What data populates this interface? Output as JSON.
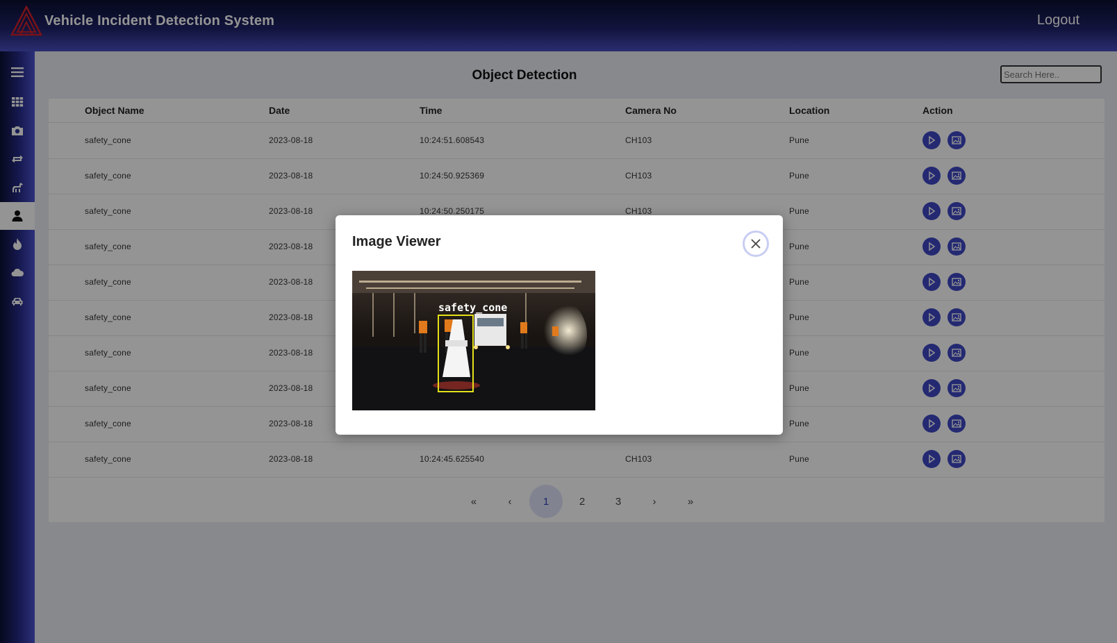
{
  "header": {
    "title": "Vehicle Incident Detection System",
    "logout_label": "Logout"
  },
  "sidebar": {
    "items": [
      {
        "icon": "menu-icon",
        "active": false
      },
      {
        "icon": "grid-icon",
        "active": false
      },
      {
        "icon": "camera-icon",
        "active": false
      },
      {
        "icon": "swap-arrows-icon",
        "active": false
      },
      {
        "icon": "horse-icon",
        "active": false
      },
      {
        "icon": "person-icon",
        "active": true
      },
      {
        "icon": "fire-icon",
        "active": false
      },
      {
        "icon": "cloud-icon",
        "active": false
      },
      {
        "icon": "car-icon",
        "active": false
      }
    ]
  },
  "main": {
    "title": "Object Detection",
    "search_placeholder": "Search Here.."
  },
  "table": {
    "columns": [
      "Object Name",
      "Date",
      "Time",
      "Camera No",
      "Location",
      "Action"
    ],
    "rows": [
      {
        "object": "safety_cone",
        "date": "2023-08-18",
        "time": "10:24:51.608543",
        "camera": "CH103",
        "location": "Pune"
      },
      {
        "object": "safety_cone",
        "date": "2023-08-18",
        "time": "10:24:50.925369",
        "camera": "CH103",
        "location": "Pune"
      },
      {
        "object": "safety_cone",
        "date": "2023-08-18",
        "time": "10:24:50.250175",
        "camera": "CH103",
        "location": "Pune"
      },
      {
        "object": "safety_cone",
        "date": "2023-08-18",
        "time": "",
        "camera": "",
        "location": "Pune"
      },
      {
        "object": "safety_cone",
        "date": "2023-08-18",
        "time": "",
        "camera": "",
        "location": "Pune"
      },
      {
        "object": "safety_cone",
        "date": "2023-08-18",
        "time": "",
        "camera": "",
        "location": "Pune"
      },
      {
        "object": "safety_cone",
        "date": "2023-08-18",
        "time": "",
        "camera": "",
        "location": "Pune"
      },
      {
        "object": "safety_cone",
        "date": "2023-08-18",
        "time": "",
        "camera": "",
        "location": "Pune"
      },
      {
        "object": "safety_cone",
        "date": "2023-08-18",
        "time": "",
        "camera": "",
        "location": "Pune"
      },
      {
        "object": "safety_cone",
        "date": "2023-08-18",
        "time": "10:24:45.625540",
        "camera": "CH103",
        "location": "Pune"
      }
    ]
  },
  "pagination": {
    "first": "«",
    "prev": "‹",
    "pages": [
      "1",
      "2",
      "3"
    ],
    "current": "1",
    "next": "›",
    "last": "»"
  },
  "modal": {
    "title": "Image Viewer",
    "detection_label": "safety_cone"
  },
  "colors": {
    "accent": "#3f47c4",
    "header_dark": "#0b1030",
    "header_light": "#4a4fc2",
    "box": "#e5e01a"
  }
}
